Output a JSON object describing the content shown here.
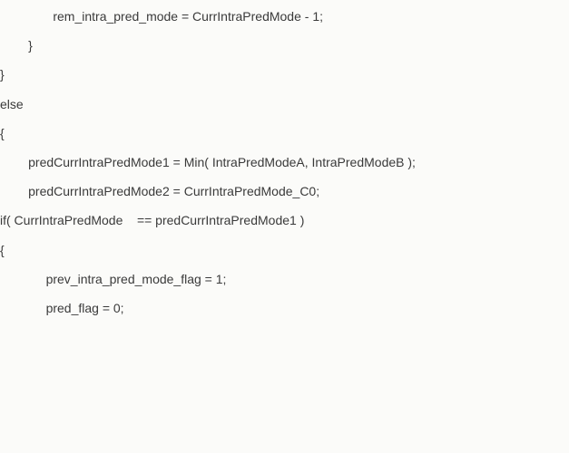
{
  "lines": [
    "               rem_intra_pred_mode = CurrIntraPredMode - 1;",
    "        }",
    "}",
    "else",
    "{",
    "        predCurrIntraPredMode1 = Min( IntraPredModeA, IntraPredModeB );",
    "        predCurrIntraPredMode2 = CurrIntraPredMode_C0;",
    "",
    "if( CurrIntraPredMode    == predCurrIntraPredMode1 )",
    "{",
    "             prev_intra_pred_mode_flag = 1;",
    "             pred_flag = 0;"
  ]
}
